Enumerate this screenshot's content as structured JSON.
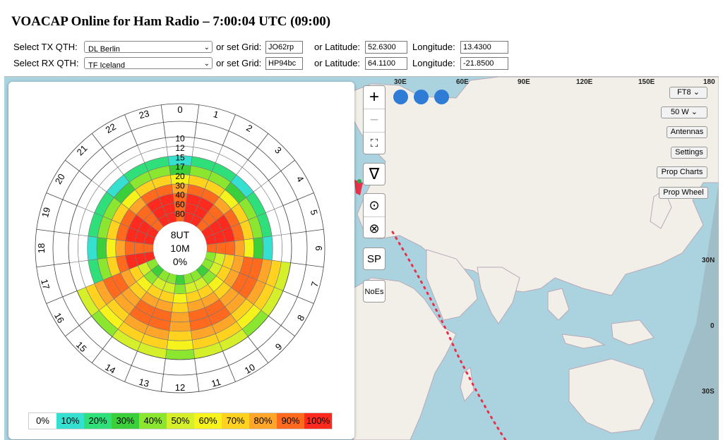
{
  "title": "VOACAP Online for Ham Radio – 7:00:04 UTC (09:00)",
  "tx": {
    "label": "Select TX QTH:",
    "select": "DL Berlin",
    "grid_label": "or set Grid:",
    "grid": "JO62rp",
    "lat_label": "or Latitude:",
    "lat": "52.6300",
    "lon_label": "Longitude:",
    "lon": "13.4300"
  },
  "rx": {
    "label": "Select RX QTH:",
    "select": "TF Iceland",
    "grid_label": "or set Grid:",
    "grid": "HP94bc",
    "lat_label": "or Latitude:",
    "lat": "64.1100",
    "lon_label": "Longitude:",
    "lon": "-21.8500"
  },
  "polar": {
    "hours": [
      "0",
      "1",
      "2",
      "3",
      "4",
      "5",
      "6",
      "7",
      "8",
      "9",
      "10",
      "11",
      "12",
      "13",
      "14",
      "15",
      "16",
      "17",
      "18",
      "19",
      "20",
      "21",
      "22",
      "23"
    ],
    "bands": [
      "80",
      "60",
      "40",
      "30",
      "20",
      "17",
      "15",
      "12",
      "10"
    ],
    "center": [
      "8UT",
      "10M",
      "0%"
    ]
  },
  "legend": [
    {
      "label": "0%",
      "color": "#ffffff"
    },
    {
      "label": "10%",
      "color": "#36e0d0"
    },
    {
      "label": "20%",
      "color": "#2fe07a"
    },
    {
      "label": "30%",
      "color": "#3ccf3c"
    },
    {
      "label": "40%",
      "color": "#8be630"
    },
    {
      "label": "50%",
      "color": "#d5ef2a"
    },
    {
      "label": "60%",
      "color": "#f5f21c"
    },
    {
      "label": "70%",
      "color": "#ffd21f"
    },
    {
      "label": "80%",
      "color": "#ffa62a"
    },
    {
      "label": "90%",
      "color": "#ff6a1e"
    },
    {
      "label": "100%",
      "color": "#ff2a1e"
    }
  ],
  "map": {
    "zoom_in": "+",
    "zoom_out": "−",
    "sp": "SP",
    "noes": "NoEs",
    "mode": "FT8",
    "power": "50 W",
    "buttons": [
      "Antennas",
      "Settings",
      "Prop Charts",
      "Prop Wheel"
    ],
    "top_labels": [
      "30E",
      "60E",
      "90E",
      "120E",
      "150E",
      "180"
    ],
    "right_labels": [
      "30N",
      "0",
      "30S"
    ]
  }
}
